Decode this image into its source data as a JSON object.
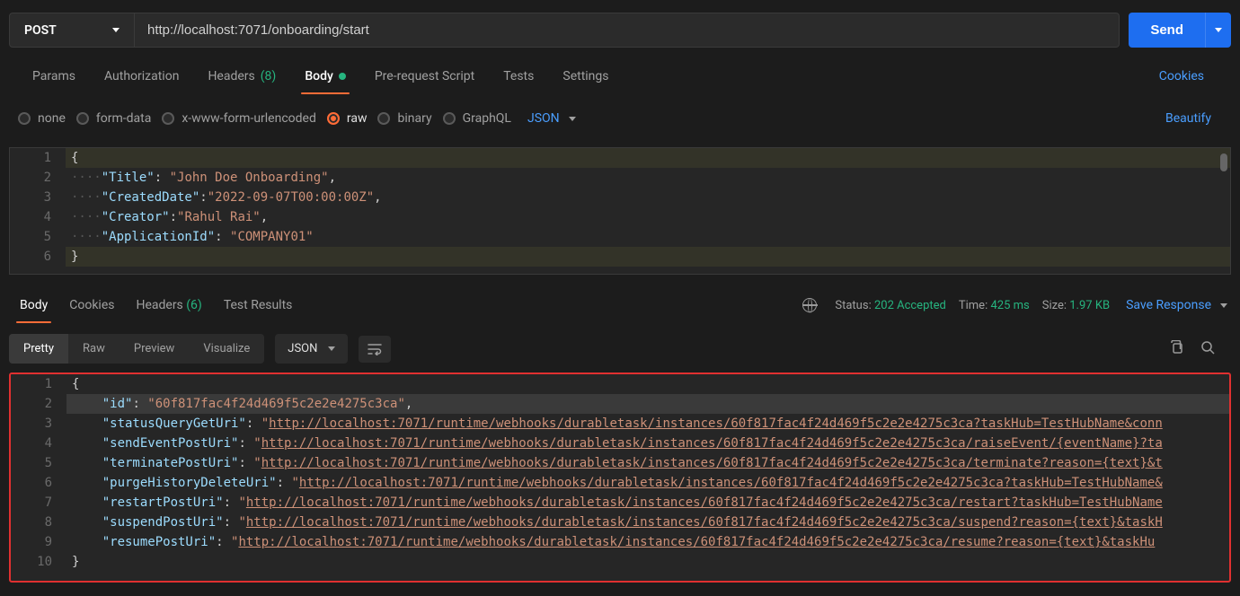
{
  "request": {
    "method": "POST",
    "url": "http://localhost:7071/onboarding/start",
    "sendLabel": "Send"
  },
  "requestTabs": {
    "params": "Params",
    "authorization": "Authorization",
    "headersLabel": "Headers ",
    "headersCount": "(8)",
    "body": "Body",
    "preRequest": "Pre-request Script",
    "tests": "Tests",
    "settings": "Settings",
    "cookies": "Cookies"
  },
  "bodyTypes": {
    "none": "none",
    "formData": "form-data",
    "urlencoded": "x-www-form-urlencoded",
    "raw": "raw",
    "binary": "binary",
    "graphql": "GraphQL",
    "jsonLabel": "JSON",
    "beautify": "Beautify"
  },
  "requestBody": {
    "line1": "{",
    "line2_key": "\"Title\"",
    "line2_val": "\"John Doe Onboarding\"",
    "line3_key": "\"CreatedDate\"",
    "line3_val": "\"2022-09-07T00:00:00Z\"",
    "line4_key": "\"Creator\"",
    "line4_val": "\"Rahul Rai\"",
    "line5_key": "\"ApplicationId\"",
    "line5_val": "\"COMPANY01\"",
    "line6": "}"
  },
  "responseTabs": {
    "body": "Body",
    "cookies": "Cookies",
    "headersLabel": "Headers ",
    "headersCount": "(6)",
    "testResults": "Test Results"
  },
  "status": {
    "statusLabel": "Status:",
    "statusValue": "202 Accepted",
    "timeLabel": "Time:",
    "timeValue": "425 ms",
    "sizeLabel": "Size:",
    "sizeValue": "1.97 KB",
    "saveResponse": "Save Response"
  },
  "viewTabs": {
    "pretty": "Pretty",
    "raw": "Raw",
    "preview": "Preview",
    "visualize": "Visualize",
    "formatLabel": "JSON"
  },
  "responseBody": {
    "l1": "{",
    "l2_key": "\"id\"",
    "l2_val": "\"60f817fac4f24d469f5c2e2e4275c3ca\"",
    "l3_key": "\"statusQueryGetUri\"",
    "l3_val": "http://localhost:7071/runtime/webhooks/durabletask/instances/60f817fac4f24d469f5c2e2e4275c3ca?taskHub=TestHubName&conn",
    "l4_key": "\"sendEventPostUri\"",
    "l4_val": "http://localhost:7071/runtime/webhooks/durabletask/instances/60f817fac4f24d469f5c2e2e4275c3ca/raiseEvent/{eventName}?ta",
    "l5_key": "\"terminatePostUri\"",
    "l5_val": "http://localhost:7071/runtime/webhooks/durabletask/instances/60f817fac4f24d469f5c2e2e4275c3ca/terminate?reason={text}&t",
    "l6_key": "\"purgeHistoryDeleteUri\"",
    "l6_val": "http://localhost:7071/runtime/webhooks/durabletask/instances/60f817fac4f24d469f5c2e2e4275c3ca?taskHub=TestHubName&",
    "l7_key": "\"restartPostUri\"",
    "l7_val": "http://localhost:7071/runtime/webhooks/durabletask/instances/60f817fac4f24d469f5c2e2e4275c3ca/restart?taskHub=TestHubName",
    "l8_key": "\"suspendPostUri\"",
    "l8_val": "http://localhost:7071/runtime/webhooks/durabletask/instances/60f817fac4f24d469f5c2e2e4275c3ca/suspend?reason={text}&taskH",
    "l9_key": "\"resumePostUri\"",
    "l9_val": "http://localhost:7071/runtime/webhooks/durabletask/instances/60f817fac4f24d469f5c2e2e4275c3ca/resume?reason={text}&taskHu",
    "l10": "}"
  }
}
